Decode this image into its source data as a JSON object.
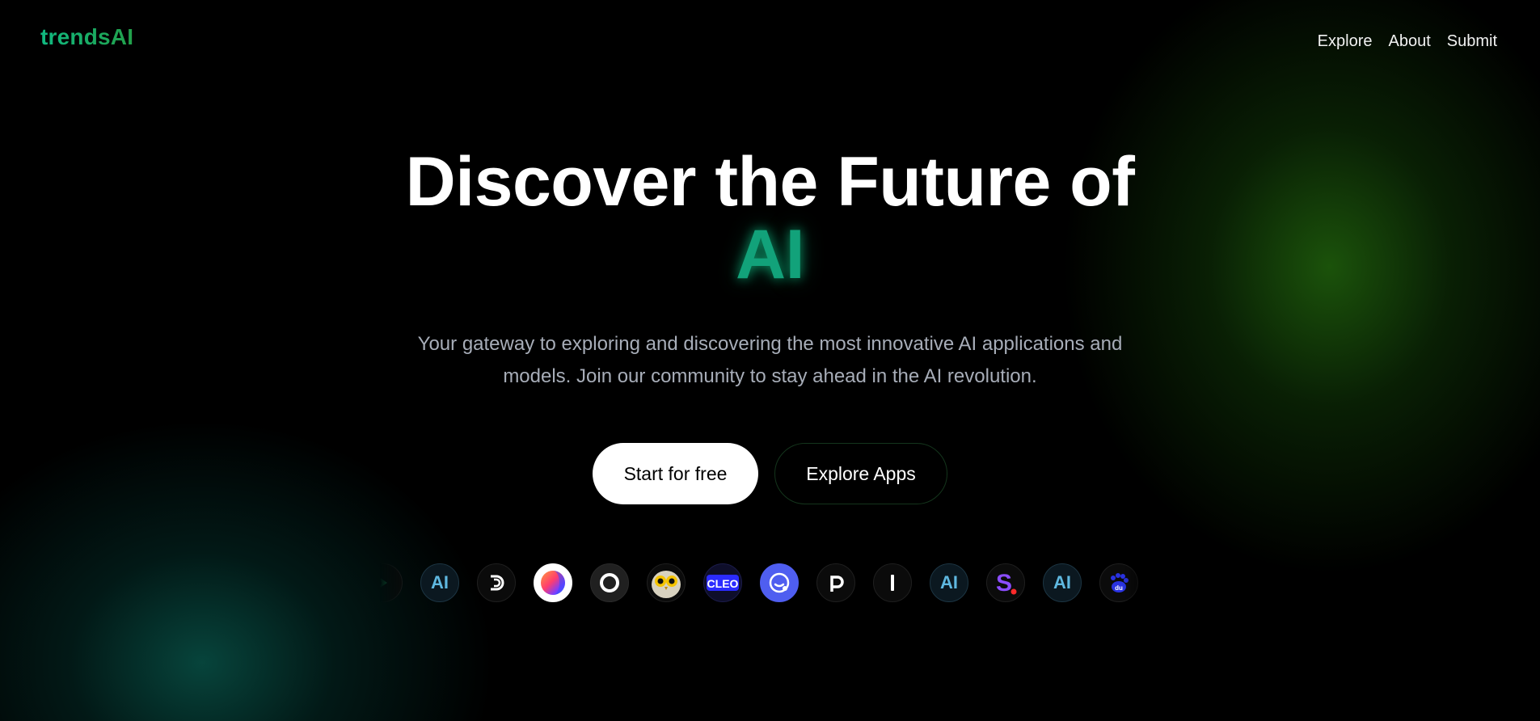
{
  "brand": {
    "name": "trendsAI"
  },
  "nav": [
    {
      "label": "Explore"
    },
    {
      "label": "About"
    },
    {
      "label": "Submit"
    }
  ],
  "hero": {
    "title_line": "Discover the Future of",
    "title_accent": "AI",
    "subtitle": "Your gateway to exploring and discovering the most innovative AI applications and models. Join our community to stay ahead in the AI revolution."
  },
  "cta": {
    "primary_label": "Start for free",
    "secondary_label": "Explore Apps"
  },
  "app_strip": {
    "icons": [
      "green-arrow-app-icon",
      "ai-app-icon",
      "d-logo-app-icon",
      "gradient-ball-app-icon",
      "ring-app-icon",
      "owl-app-icon",
      "cleo-app-icon",
      "smiley-face-app-icon",
      "p-logo-app-icon",
      "bar-logo-app-icon",
      "ai-app-icon",
      "s-logo-app-icon",
      "ai-app-icon",
      "baidu-paw-app-icon",
      "partial-app-icon"
    ],
    "labels": {
      "ai": "AI",
      "cleo": "CLEO",
      "baidu": "du"
    }
  },
  "colors": {
    "background": "#000000",
    "accent_green": "#12a27a",
    "glow_right": "#246e0e",
    "glow_left": "#085046",
    "subtitle_gray": "#a7adb8"
  }
}
